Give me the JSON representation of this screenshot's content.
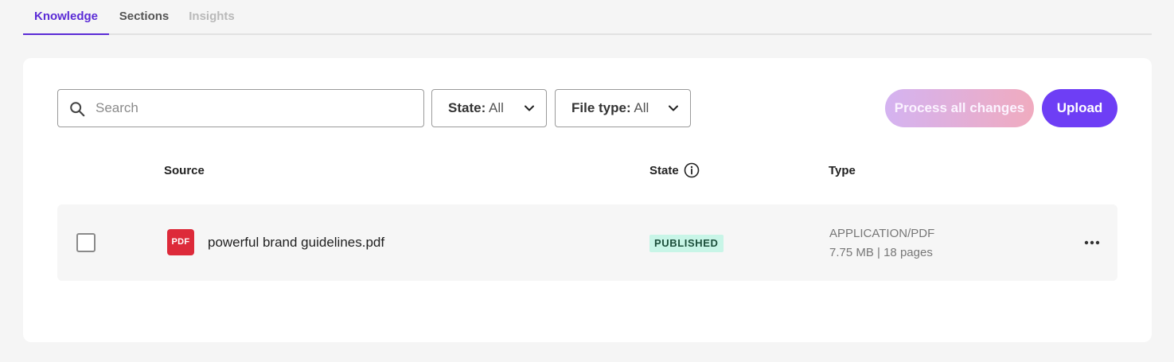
{
  "tabs": [
    {
      "label": "Knowledge",
      "state": "active"
    },
    {
      "label": "Sections",
      "state": "normal"
    },
    {
      "label": "Insights",
      "state": "disabled"
    }
  ],
  "toolbar": {
    "search_placeholder": "Search",
    "state_filter": {
      "label": "State:",
      "value": "All"
    },
    "filetype_filter": {
      "label": "File type:",
      "value": "All"
    },
    "process_label": "Process all changes",
    "upload_label": "Upload"
  },
  "table": {
    "headers": {
      "source": "Source",
      "state": "State",
      "type": "Type"
    },
    "rows": [
      {
        "icon_text": "PDF",
        "filename": "powerful brand guidelines.pdf",
        "state": "PUBLISHED",
        "type": "APPLICATION/PDF",
        "meta": "7.75 MB | 18 pages"
      }
    ]
  },
  "colors": {
    "accent": "#5b2bd6",
    "upload": "#6e3ef5",
    "badge_bg": "#c8f5e7",
    "pdf_red": "#dd2a3a"
  },
  "icons": [
    "search-icon",
    "chevron-down-icon",
    "info-icon",
    "pdf-file-icon",
    "more-options-icon"
  ]
}
